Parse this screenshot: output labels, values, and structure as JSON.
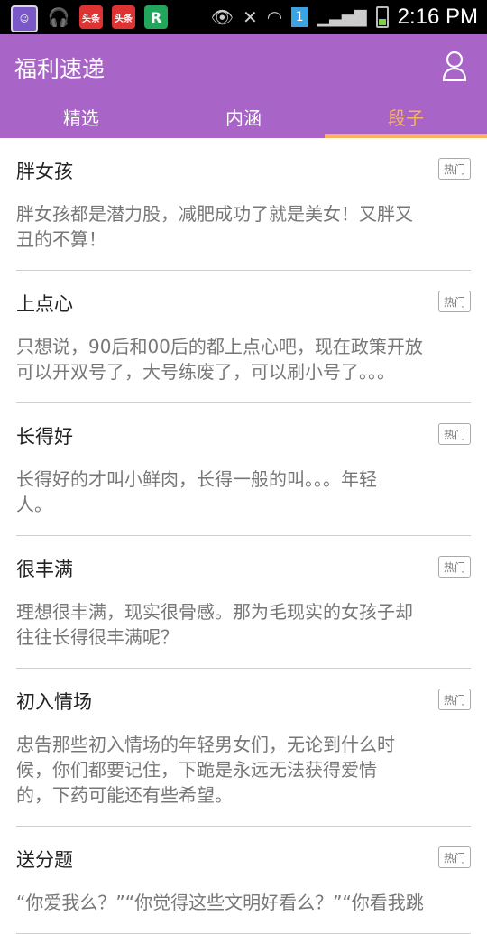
{
  "status_bar": {
    "time": "2:16 PM",
    "toutiao_1": "头条",
    "toutiao_2": "头条",
    "r_app": "R",
    "sim": "1"
  },
  "app_bar": {
    "title": "福利速递",
    "tabs": [
      {
        "label": "精选"
      },
      {
        "label": "内涵"
      },
      {
        "label": "段子"
      }
    ],
    "active_tab": "段子",
    "accent_color": "#a865c7",
    "active_color": "#f9b25d"
  },
  "items": [
    {
      "title": "胖女孩",
      "badge": "热门",
      "body": "胖女孩都是潜力股，减肥成功了就是美女！又胖又\n丑的不算！"
    },
    {
      "title": "上点心",
      "badge": "热门",
      "body": "只想说，90后和00后的都上点心吧，现在政策开放\n可以开双号了，大号练废了，可以刷小号了。。。"
    },
    {
      "title": "长得好",
      "badge": "热门",
      "body": "长得好的才叫小鲜肉，长得一般的叫。。。年轻\n人。"
    },
    {
      "title": "很丰满",
      "badge": "热门",
      "body": "理想很丰满，现实很骨感。那为毛现实的女孩子却\n往往长得很丰满呢？"
    },
    {
      "title": "初入情场",
      "badge": "热门",
      "body": "忠告那些初入情场的年轻男女们，无论到什么时\n候，你们都要记住，下跪是永远无法获得爱情\n的，下药可能还有些希望。"
    },
    {
      "title": "送分题",
      "badge": "热门",
      "body": "“你爱我么？”“你觉得这些文明好看么？”“你看我跳"
    }
  ]
}
